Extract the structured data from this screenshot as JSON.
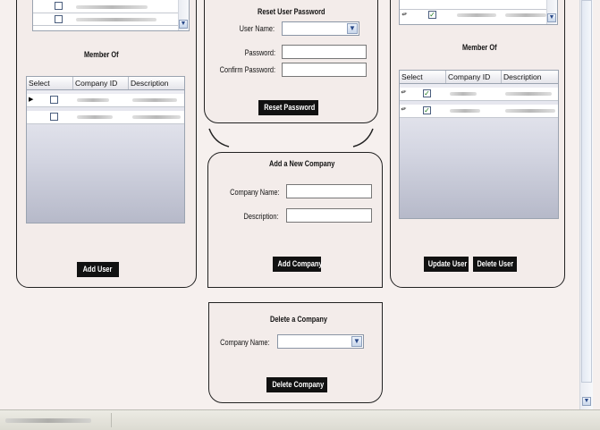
{
  "left_panel": {
    "member_of_label": "Member Of",
    "grid_headers": [
      "Select",
      "Company ID",
      "Description"
    ],
    "add_user_label": "Add User"
  },
  "reset_password": {
    "title": "Reset User Password",
    "user_name_label": "User Name:",
    "password_label": "Password:",
    "confirm_password_label": "Confirm Password:",
    "button_label": "Reset Password"
  },
  "add_company": {
    "title": "Add a New Company",
    "company_name_label": "Company Name:",
    "description_label": "Description:",
    "button_label": "Add Company"
  },
  "delete_company": {
    "title": "Delete a Company",
    "company_name_label": "Company Name:",
    "button_label": "Delete Company"
  },
  "right_panel": {
    "member_of_label": "Member Of",
    "grid_headers": [
      "Select",
      "Company ID",
      "Description"
    ],
    "update_user_label": "Update User",
    "delete_user_label": "Delete User"
  },
  "icons": {
    "scroll_down": "chevron-down-icon",
    "scroll_up": "chevron-up-icon",
    "row_pointer": "row-pointer-icon",
    "row_edit": "pencil-icon"
  },
  "colors": {
    "background": "#f6f0ee",
    "button": "#111111",
    "checkmark": "#1c7a1c"
  }
}
